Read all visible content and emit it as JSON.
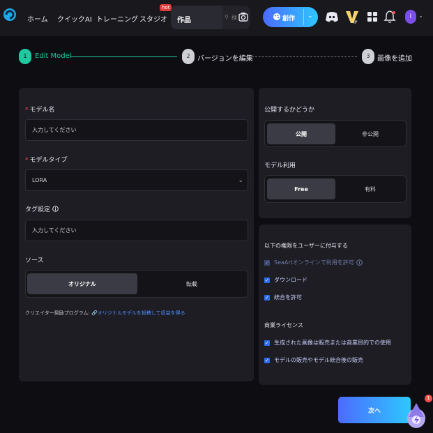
{
  "nav": {
    "items": [
      "ホーム",
      "クイックAI",
      "トレーニング",
      "スタジオ"
    ],
    "hot_badge": "hot",
    "select_value": "作品",
    "search_placeholder": "検",
    "create_label": "創作"
  },
  "stepper": {
    "steps": [
      {
        "number": "1",
        "label": "Edit Model"
      },
      {
        "number": "2",
        "label": "バージョンを編集"
      },
      {
        "number": "3",
        "label": "画像を追加"
      }
    ]
  },
  "form": {
    "model_name": {
      "label": "モデル名",
      "required_mark": "*",
      "placeholder": "入力してください"
    },
    "model_type": {
      "label": "モデルタイプ",
      "required_mark": "*",
      "value": "LORA"
    },
    "tags": {
      "label": "タグ設定",
      "info_icon": "info-icon",
      "placeholder": "入力してください"
    },
    "source": {
      "label": "ソース",
      "options": [
        "オリジナル",
        "転載"
      ],
      "selected": "オリジナル"
    },
    "promo": {
      "text": "クリエイター奨励プログラム:",
      "link": "オリジナルモデルを投稿して収益を得る"
    }
  },
  "publish": {
    "label": "公開するかどうか",
    "options": [
      "公開",
      "非公開"
    ],
    "selected": "公開"
  },
  "usage": {
    "label": "モデル利用",
    "options": [
      "Free",
      "有料"
    ],
    "selected": "Free"
  },
  "permissions": {
    "title": "以下の権限をユーザーに付与する",
    "items": [
      {
        "label": "SeaArtオンラインで利用を許可",
        "checked": true,
        "disabled": true
      },
      {
        "label": "ダウンロード",
        "checked": true,
        "disabled": false
      },
      {
        "label": "統合を許可",
        "checked": true,
        "disabled": false
      }
    ]
  },
  "license": {
    "title": "商業ライセンス",
    "items": [
      {
        "label": "生成された画像は販売または商業目的での使用",
        "checked": true
      },
      {
        "label": "モデルの販売やモデル統合後の販売",
        "checked": true
      }
    ]
  },
  "footer": {
    "next_label": "次へ",
    "mascot_badge": "1"
  },
  "colors": {
    "accent_teal": "#1fc8a0",
    "accent_blue": "#2f6be6",
    "required_red": "#ff4d4f"
  }
}
